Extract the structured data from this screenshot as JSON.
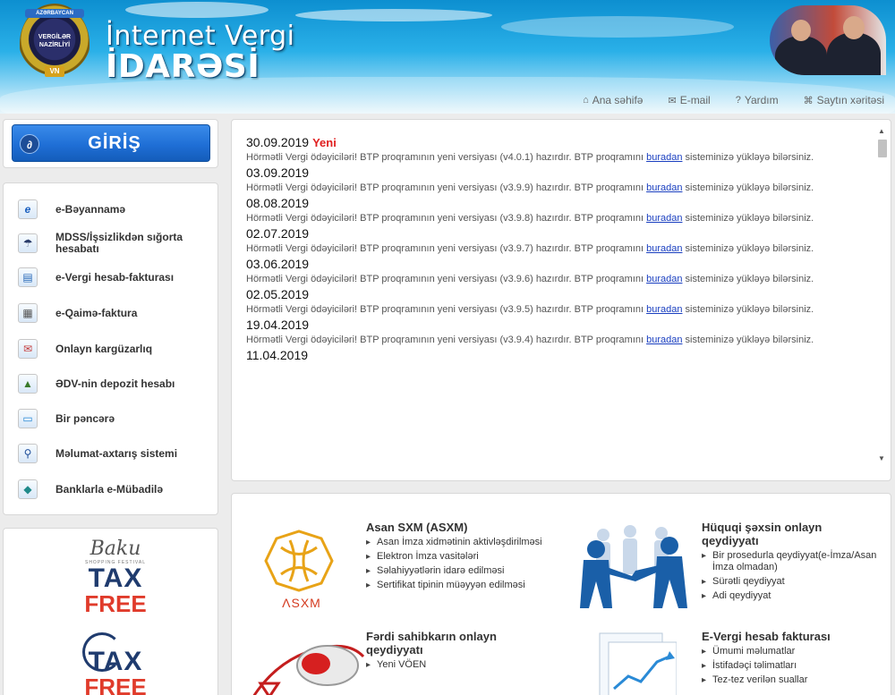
{
  "header": {
    "title_line1": "İnternet Vergi",
    "title_line2": "İDARƏSİ",
    "logo_ribbon": "AZƏRBAYCAN",
    "logo_text": "VERGİLƏR NAZİRLİYİ",
    "logo_mark": "VN",
    "nav": [
      {
        "label": "Ana səhifə",
        "icon": "home-icon"
      },
      {
        "label": "E-mail",
        "icon": "mail-icon"
      },
      {
        "label": "Yardım",
        "icon": "help-icon"
      },
      {
        "label": "Saytın xəritəsi",
        "icon": "sitemap-icon"
      }
    ]
  },
  "login": {
    "label": "GİRİŞ",
    "icon_glyph": "∂"
  },
  "menu": [
    {
      "label": "e-Bəyannamə",
      "icon": "e-declaration-icon",
      "glyph": "e"
    },
    {
      "label": "MDSS/İşsizlikdən sığorta hesabatı",
      "icon": "insurance-icon",
      "glyph": "☂"
    },
    {
      "label": "e-Vergi hesab-fakturası",
      "icon": "invoice-icon",
      "glyph": "▤"
    },
    {
      "label": "e-Qaimə-faktura",
      "icon": "waybill-icon",
      "glyph": "▦"
    },
    {
      "label": "Onlayn kargüzarlıq",
      "icon": "office-icon",
      "glyph": "✉"
    },
    {
      "label": "ƏDV-nin depozit hesabı",
      "icon": "deposit-icon",
      "glyph": "▲"
    },
    {
      "label": "Bir pəncərə",
      "icon": "window-icon",
      "glyph": "▭"
    },
    {
      "label": "Məlumat-axtarış sistemi",
      "icon": "search-icon",
      "glyph": "⚲"
    },
    {
      "label": "Banklarla e-Mübadilə",
      "icon": "bank-exchange-icon",
      "glyph": "◆"
    }
  ],
  "promo": {
    "logo1": {
      "baku": "Baku",
      "sub": "SHOPPING FESTIVAL",
      "tax": "TAX",
      "free": "FREE"
    },
    "logo2": {
      "tax": "TAX",
      "free": "FREE"
    }
  },
  "news": {
    "new_badge": "Yeni",
    "text_before": "Hörmətli Vergi ödəyiciləri! BTP proqramının yeni versiyası (",
    "text_middle": ") hazırdır. BTP proqramını ",
    "link": "buradan",
    "text_after": " sisteminizə yükləyə bilərsiniz.",
    "items": [
      {
        "date": "30.09.2019",
        "version": "v4.0.1",
        "is_new": true
      },
      {
        "date": "03.09.2019",
        "version": "v3.9.9",
        "is_new": false
      },
      {
        "date": "08.08.2019",
        "version": "v3.9.8",
        "is_new": false
      },
      {
        "date": "02.07.2019",
        "version": "v3.9.7",
        "is_new": false
      },
      {
        "date": "03.06.2019",
        "version": "v3.9.6",
        "is_new": false
      },
      {
        "date": "02.05.2019",
        "version": "v3.9.5",
        "is_new": false
      },
      {
        "date": "19.04.2019",
        "version": "v3.9.4",
        "is_new": false
      },
      {
        "date": "11.04.2019",
        "version": "",
        "is_new": false
      }
    ]
  },
  "services": {
    "asxm": {
      "title": "Asan SXM (ASXM)",
      "logo_text": "ΛSXM",
      "items": [
        "Asan İmza xidmətinin aktivləşdirilməsi",
        "Elektron İmza vasitələri",
        "Səlahiyyətlərin idarə edilməsi",
        "Sertifikat tipinin müəyyən edilməsi"
      ]
    },
    "legal": {
      "title": "Hüquqi şəxsin onlayn qeydiyyatı",
      "items": [
        "Bir prosedurla qeydiyyat(e-İmza/Asan İmza olmadan)",
        "Sürətli qeydiyyat",
        "Adi qeydiyyat"
      ]
    },
    "individual": {
      "title": "Fərdi sahibkarın onlayn qeydiyyatı",
      "items": [
        "Yeni VÖEN"
      ]
    },
    "evergi": {
      "title": "E-Vergi hesab fakturası",
      "items": [
        "Ümumi məlumatlar",
        "İstifadəçi təlimatları",
        "Tez-tez verilən suallar"
      ]
    }
  }
}
